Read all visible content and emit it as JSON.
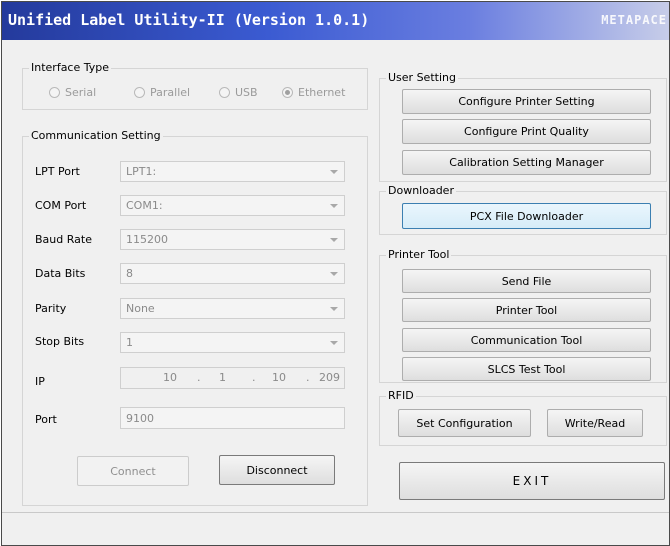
{
  "window": {
    "title": "Unified Label Utility-II (Version 1.0.1)",
    "brand": "METAPACE"
  },
  "interface": {
    "label": "Interface Type",
    "options": [
      "Serial",
      "Parallel",
      "USB",
      "Ethernet"
    ],
    "selected": "Ethernet"
  },
  "comm": {
    "label": "Communication Setting",
    "lpt_label": "LPT Port",
    "lpt_value": "LPT1:",
    "com_label": "COM Port",
    "com_value": "COM1:",
    "baud_label": "Baud Rate",
    "baud_value": "115200",
    "data_label": "Data Bits",
    "data_value": "8",
    "parity_label": "Parity",
    "parity_value": "None",
    "stop_label": "Stop Bits",
    "stop_value": "1",
    "ip_label": "IP",
    "ip_octets": [
      "10",
      "1",
      "10",
      "209"
    ],
    "ip_dot": ".",
    "port_label": "Port",
    "port_value": "9100",
    "connect": "Connect",
    "disconnect": "Disconnect"
  },
  "user_setting": {
    "label": "User Setting",
    "buttons": [
      "Configure Printer Setting",
      "Configure Print Quality",
      "Calibration Setting Manager"
    ]
  },
  "downloader": {
    "label": "Downloader",
    "button": "PCX File Downloader"
  },
  "printer_tool": {
    "label": "Printer Tool",
    "buttons": [
      "Send File",
      "Printer Tool",
      "Communication Tool",
      "SLCS Test Tool"
    ]
  },
  "rfid": {
    "label": "RFID",
    "set_config": "Set Configuration",
    "write_read": "Write/Read"
  },
  "exit_label": "EXIT"
}
